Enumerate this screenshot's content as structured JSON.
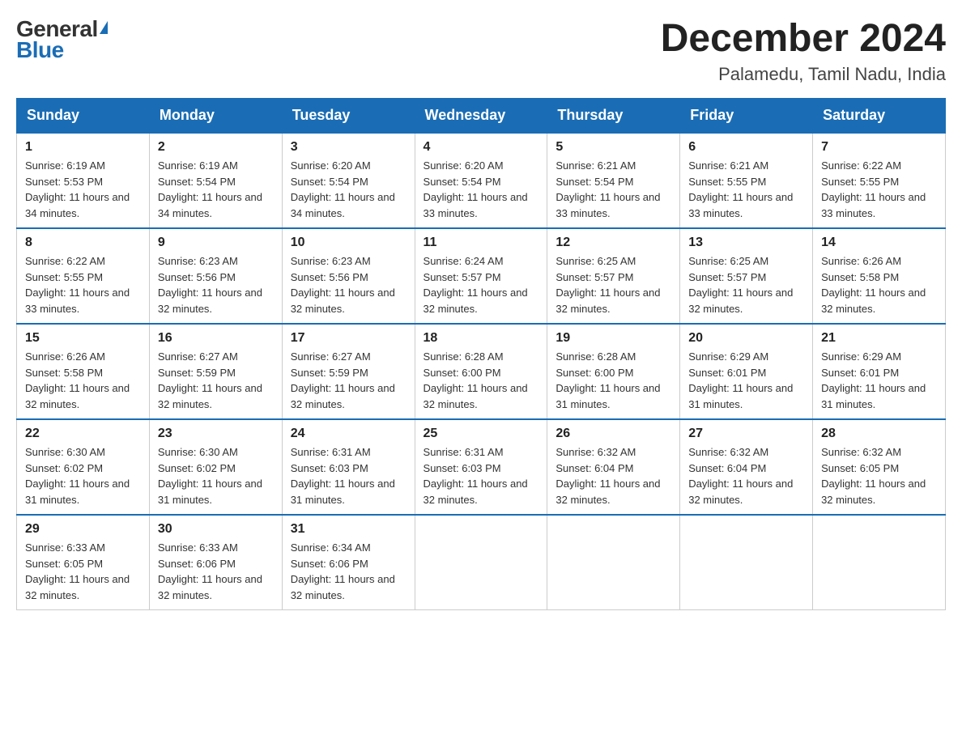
{
  "header": {
    "logo_general": "General",
    "logo_blue": "Blue",
    "month_title": "December 2024",
    "location": "Palamedu, Tamil Nadu, India"
  },
  "days_of_week": [
    "Sunday",
    "Monday",
    "Tuesday",
    "Wednesday",
    "Thursday",
    "Friday",
    "Saturday"
  ],
  "weeks": [
    [
      {
        "day": 1,
        "sunrise": "6:19 AM",
        "sunset": "5:53 PM",
        "daylight": "11 hours and 34 minutes."
      },
      {
        "day": 2,
        "sunrise": "6:19 AM",
        "sunset": "5:54 PM",
        "daylight": "11 hours and 34 minutes."
      },
      {
        "day": 3,
        "sunrise": "6:20 AM",
        "sunset": "5:54 PM",
        "daylight": "11 hours and 34 minutes."
      },
      {
        "day": 4,
        "sunrise": "6:20 AM",
        "sunset": "5:54 PM",
        "daylight": "11 hours and 33 minutes."
      },
      {
        "day": 5,
        "sunrise": "6:21 AM",
        "sunset": "5:54 PM",
        "daylight": "11 hours and 33 minutes."
      },
      {
        "day": 6,
        "sunrise": "6:21 AM",
        "sunset": "5:55 PM",
        "daylight": "11 hours and 33 minutes."
      },
      {
        "day": 7,
        "sunrise": "6:22 AM",
        "sunset": "5:55 PM",
        "daylight": "11 hours and 33 minutes."
      }
    ],
    [
      {
        "day": 8,
        "sunrise": "6:22 AM",
        "sunset": "5:55 PM",
        "daylight": "11 hours and 33 minutes."
      },
      {
        "day": 9,
        "sunrise": "6:23 AM",
        "sunset": "5:56 PM",
        "daylight": "11 hours and 32 minutes."
      },
      {
        "day": 10,
        "sunrise": "6:23 AM",
        "sunset": "5:56 PM",
        "daylight": "11 hours and 32 minutes."
      },
      {
        "day": 11,
        "sunrise": "6:24 AM",
        "sunset": "5:57 PM",
        "daylight": "11 hours and 32 minutes."
      },
      {
        "day": 12,
        "sunrise": "6:25 AM",
        "sunset": "5:57 PM",
        "daylight": "11 hours and 32 minutes."
      },
      {
        "day": 13,
        "sunrise": "6:25 AM",
        "sunset": "5:57 PM",
        "daylight": "11 hours and 32 minutes."
      },
      {
        "day": 14,
        "sunrise": "6:26 AM",
        "sunset": "5:58 PM",
        "daylight": "11 hours and 32 minutes."
      }
    ],
    [
      {
        "day": 15,
        "sunrise": "6:26 AM",
        "sunset": "5:58 PM",
        "daylight": "11 hours and 32 minutes."
      },
      {
        "day": 16,
        "sunrise": "6:27 AM",
        "sunset": "5:59 PM",
        "daylight": "11 hours and 32 minutes."
      },
      {
        "day": 17,
        "sunrise": "6:27 AM",
        "sunset": "5:59 PM",
        "daylight": "11 hours and 32 minutes."
      },
      {
        "day": 18,
        "sunrise": "6:28 AM",
        "sunset": "6:00 PM",
        "daylight": "11 hours and 32 minutes."
      },
      {
        "day": 19,
        "sunrise": "6:28 AM",
        "sunset": "6:00 PM",
        "daylight": "11 hours and 31 minutes."
      },
      {
        "day": 20,
        "sunrise": "6:29 AM",
        "sunset": "6:01 PM",
        "daylight": "11 hours and 31 minutes."
      },
      {
        "day": 21,
        "sunrise": "6:29 AM",
        "sunset": "6:01 PM",
        "daylight": "11 hours and 31 minutes."
      }
    ],
    [
      {
        "day": 22,
        "sunrise": "6:30 AM",
        "sunset": "6:02 PM",
        "daylight": "11 hours and 31 minutes."
      },
      {
        "day": 23,
        "sunrise": "6:30 AM",
        "sunset": "6:02 PM",
        "daylight": "11 hours and 31 minutes."
      },
      {
        "day": 24,
        "sunrise": "6:31 AM",
        "sunset": "6:03 PM",
        "daylight": "11 hours and 31 minutes."
      },
      {
        "day": 25,
        "sunrise": "6:31 AM",
        "sunset": "6:03 PM",
        "daylight": "11 hours and 32 minutes."
      },
      {
        "day": 26,
        "sunrise": "6:32 AM",
        "sunset": "6:04 PM",
        "daylight": "11 hours and 32 minutes."
      },
      {
        "day": 27,
        "sunrise": "6:32 AM",
        "sunset": "6:04 PM",
        "daylight": "11 hours and 32 minutes."
      },
      {
        "day": 28,
        "sunrise": "6:32 AM",
        "sunset": "6:05 PM",
        "daylight": "11 hours and 32 minutes."
      }
    ],
    [
      {
        "day": 29,
        "sunrise": "6:33 AM",
        "sunset": "6:05 PM",
        "daylight": "11 hours and 32 minutes."
      },
      {
        "day": 30,
        "sunrise": "6:33 AM",
        "sunset": "6:06 PM",
        "daylight": "11 hours and 32 minutes."
      },
      {
        "day": 31,
        "sunrise": "6:34 AM",
        "sunset": "6:06 PM",
        "daylight": "11 hours and 32 minutes."
      },
      null,
      null,
      null,
      null
    ]
  ]
}
